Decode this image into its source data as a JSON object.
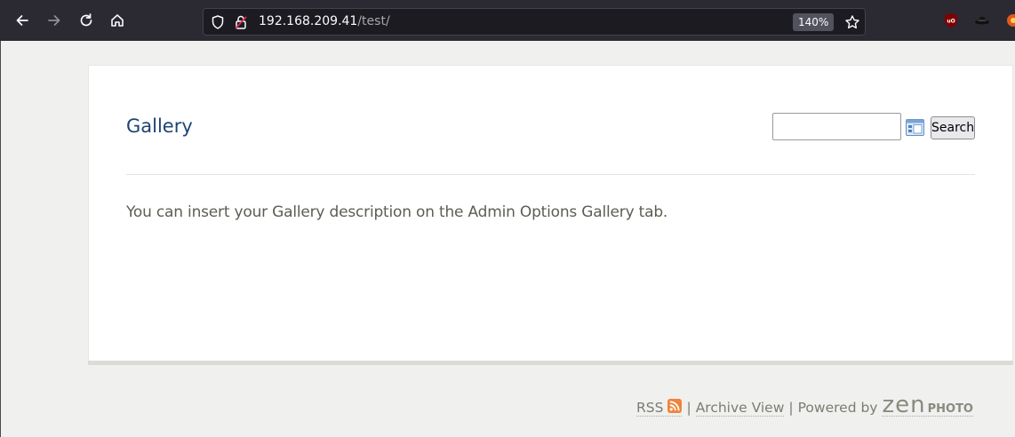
{
  "browser": {
    "url_host": "192.168.209.41",
    "url_path": "/test/",
    "zoom": "140%"
  },
  "page": {
    "title": "Gallery",
    "search": {
      "value": "",
      "button_label": "Search"
    },
    "description": "You can insert your Gallery description on the Admin Options Gallery tab."
  },
  "footer": {
    "rss_label": "RSS",
    "sep1": "|",
    "archive_label": "Archive View",
    "sep2": "|",
    "powered_by": "Powered by",
    "logo_zen": "zen",
    "logo_photo": "PHOTO"
  },
  "colors": {
    "toolbar_bg": "#2b2a33",
    "title": "#1d4574",
    "rss": "#f0843a"
  },
  "icons": [
    "back-icon",
    "forward-icon",
    "reload-icon",
    "home-icon",
    "shield-icon",
    "lock-icon",
    "star-icon",
    "ublock-icon",
    "extension-icon",
    "search-options-icon",
    "rss-icon"
  ]
}
